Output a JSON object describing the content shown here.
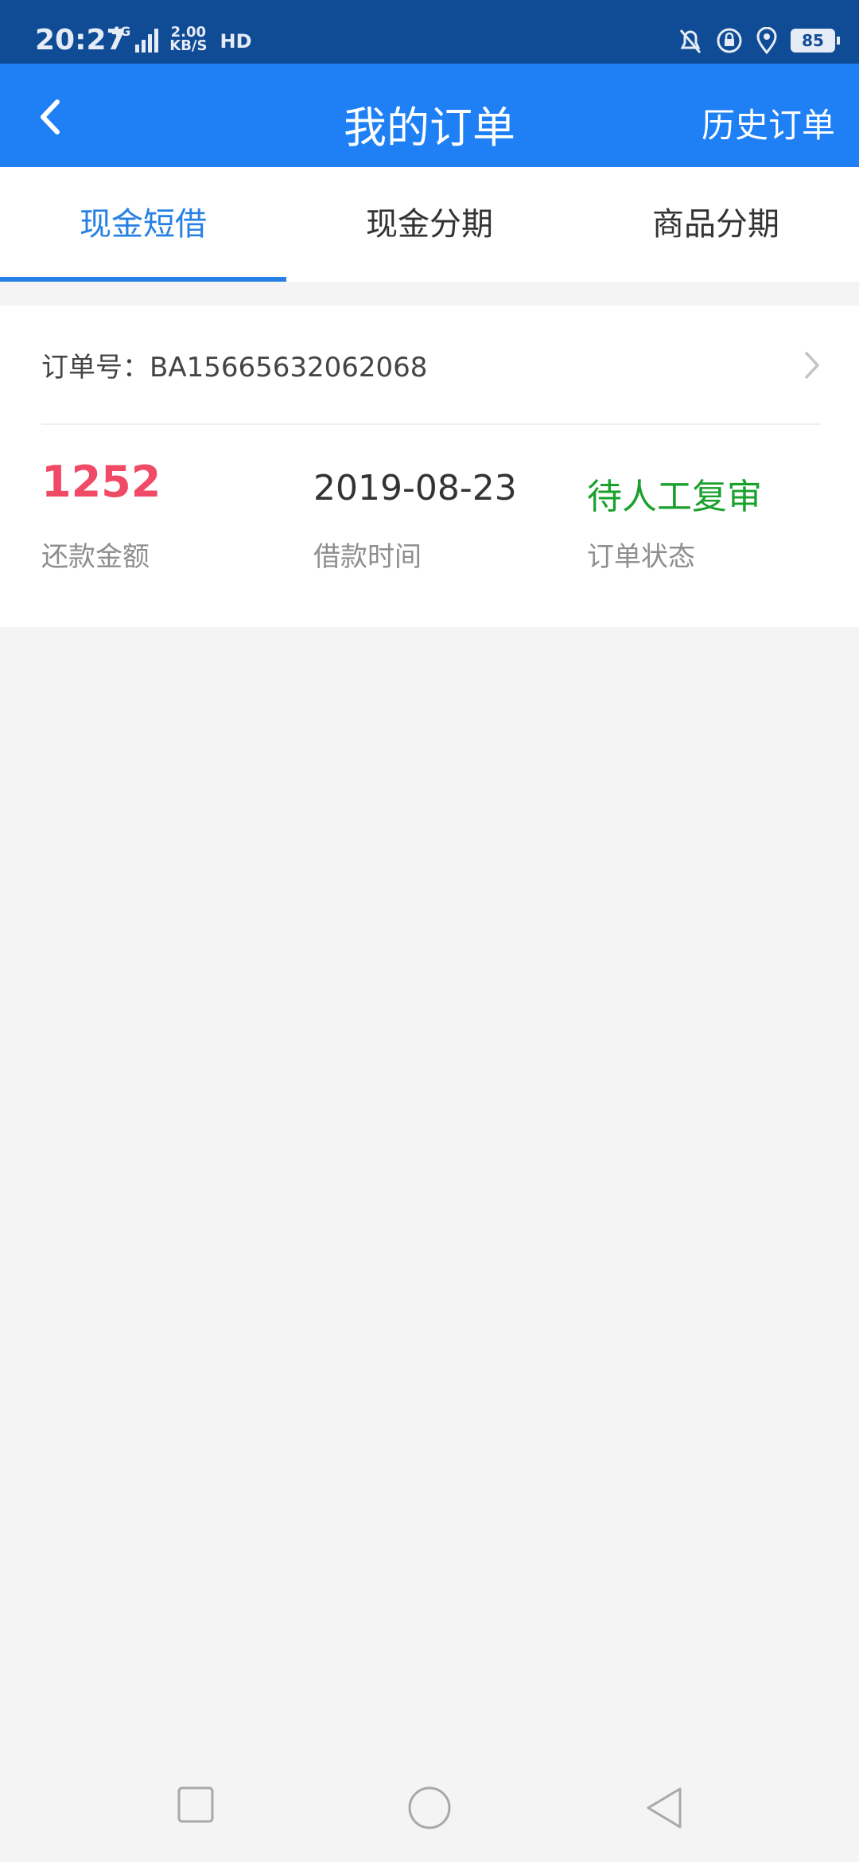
{
  "status_bar": {
    "time": "20:27",
    "network": "4G",
    "speed_value": "2.00",
    "speed_unit": "KB/S",
    "hd": "HD",
    "battery": "85"
  },
  "navbar": {
    "title": "我的订单",
    "history_label": "历史订单"
  },
  "tabs": [
    {
      "label": "现金短借",
      "active": true
    },
    {
      "label": "现金分期",
      "active": false
    },
    {
      "label": "商品分期",
      "active": false
    }
  ],
  "order": {
    "order_no_label": "订单号：",
    "order_no": "BA15665632062068",
    "amount_value": "1252",
    "amount_label": "还款金额",
    "loan_date_value": "2019-08-23",
    "loan_date_label": "借款时间",
    "status_value": "待人工复审",
    "status_label": "订单状态"
  },
  "colors": {
    "status_bar": "#104b96",
    "nav_bar": "#1f80f5",
    "tab_active": "#2780e3",
    "amount": "#f04a66",
    "status": "#1aa02d"
  },
  "icons": {
    "back": "chevron-left-icon",
    "order_arrow": "chevron-right-icon",
    "nav_recents": "square-icon",
    "nav_home": "circle-icon",
    "nav_back": "triangle-back-icon"
  }
}
